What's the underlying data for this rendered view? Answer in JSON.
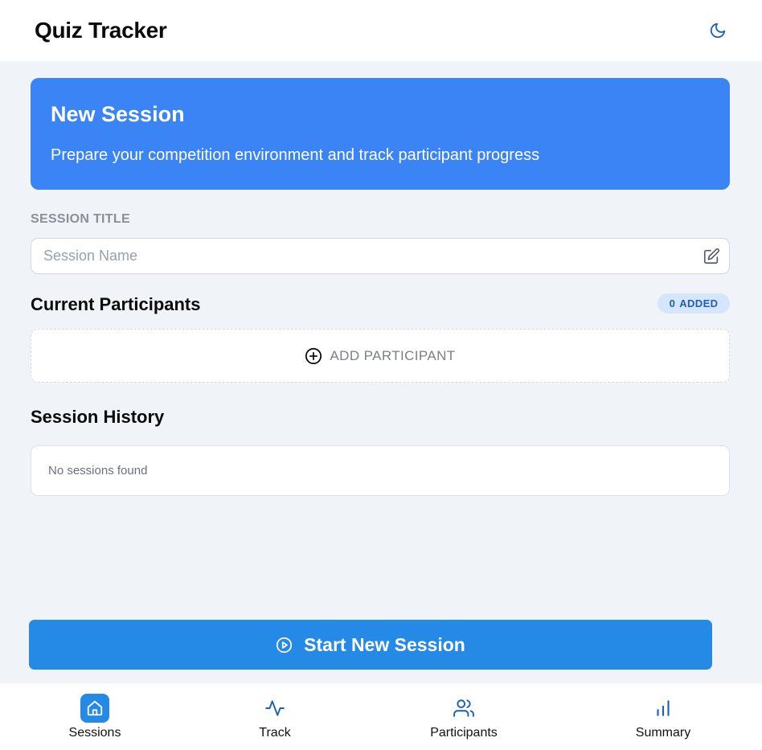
{
  "header": {
    "title": "Quiz Tracker",
    "theme_icon": "moon-icon"
  },
  "hero": {
    "title": "New Session",
    "subtitle": "Prepare your competition environment and track participant progress"
  },
  "session_title": {
    "label": "SESSION TITLE",
    "placeholder": "Session Name",
    "value": ""
  },
  "participants": {
    "title": "Current Participants",
    "count": "0",
    "count_suffix": "ADDED",
    "add_label": "ADD PARTICIPANT"
  },
  "history": {
    "title": "Session History",
    "empty_text": "No sessions found"
  },
  "start_button": {
    "label": "Start New Session"
  },
  "nav": {
    "items": [
      {
        "label": "Sessions",
        "icon": "home-icon",
        "active": true
      },
      {
        "label": "Track",
        "icon": "activity-icon",
        "active": false
      },
      {
        "label": "Participants",
        "icon": "users-icon",
        "active": false
      },
      {
        "label": "Summary",
        "icon": "bar-chart-icon",
        "active": false
      }
    ]
  },
  "colors": {
    "accent": "#2589e6",
    "hero_bg": "#3b84f5",
    "page_bg": "#f0f3f8",
    "badge_bg": "#d5e6fb",
    "badge_text": "#1f5fb8"
  }
}
